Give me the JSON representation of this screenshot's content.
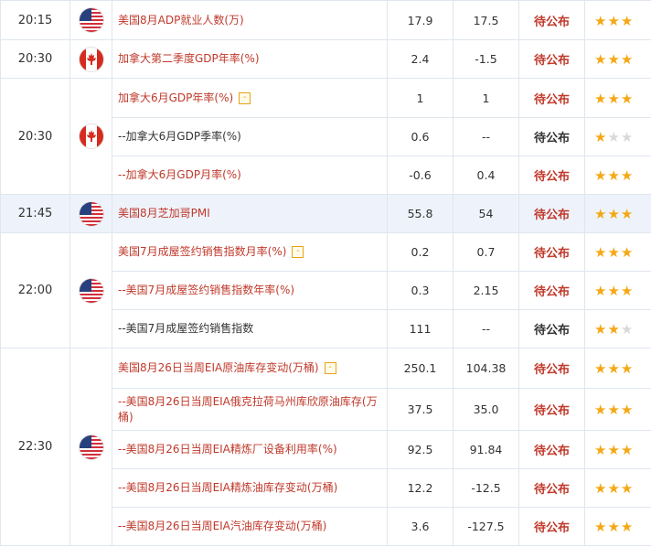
{
  "colors": {
    "accent_red": "#c0392b",
    "star_on": "#f5a814",
    "star_off": "#d9d9d9",
    "highlight_row": "#eef3fb"
  },
  "groups": [
    {
      "time": "20:15",
      "flag": "us-flag-icon",
      "rows": [
        {
          "name": "美国8月ADP就业人数(万)",
          "prev": "17.9",
          "forecast": "17.5",
          "actual": "待公布",
          "stars": 3,
          "badge": false,
          "name_color": "red"
        }
      ]
    },
    {
      "time": "20:30",
      "flag": "ca-flag-icon",
      "rows": [
        {
          "name": "加拿大第二季度GDP年率(%)",
          "prev": "2.4",
          "forecast": "-1.5",
          "actual": "待公布",
          "stars": 3,
          "badge": false,
          "name_color": "red"
        }
      ]
    },
    {
      "time": "20:30",
      "flag": "ca-flag-icon",
      "rows": [
        {
          "name": "加拿大6月GDP年率(%)",
          "prev": "1",
          "forecast": "1",
          "actual": "待公布",
          "stars": 3,
          "badge": true,
          "name_color": "red"
        },
        {
          "name": "--加拿大6月GDP季率(%)",
          "prev": "0.6",
          "forecast": "--",
          "actual": "待公布",
          "stars": 1,
          "badge": false,
          "name_color": "dark"
        },
        {
          "name": "--加拿大6月GDP月率(%)",
          "prev": "-0.6",
          "forecast": "0.4",
          "actual": "待公布",
          "stars": 3,
          "badge": false,
          "name_color": "red"
        }
      ]
    },
    {
      "time": "21:45",
      "flag": "us-flag-icon",
      "highlight": true,
      "rows": [
        {
          "name": "美国8月芝加哥PMI",
          "prev": "55.8",
          "forecast": "54",
          "actual": "待公布",
          "stars": 3,
          "badge": false,
          "name_color": "red"
        }
      ]
    },
    {
      "time": "22:00",
      "flag": "us-flag-icon",
      "rows": [
        {
          "name": "美国7月成屋签约销售指数月率(%)",
          "prev": "0.2",
          "forecast": "0.7",
          "actual": "待公布",
          "stars": 3,
          "badge": true,
          "name_color": "red"
        },
        {
          "name": "--美国7月成屋签约销售指数年率(%)",
          "prev": "0.3",
          "forecast": "2.15",
          "actual": "待公布",
          "stars": 3,
          "badge": false,
          "name_color": "red"
        },
        {
          "name": "--美国7月成屋签约销售指数",
          "prev": "111",
          "forecast": "--",
          "actual": "待公布",
          "stars": 2,
          "badge": false,
          "name_color": "dark"
        }
      ]
    },
    {
      "time": "22:30",
      "flag": "us-flag-icon",
      "rows": [
        {
          "name": "美国8月26日当周EIA原油库存变动(万桶)",
          "prev": "250.1",
          "forecast": "104.38",
          "actual": "待公布",
          "stars": 3,
          "badge": true,
          "name_color": "red"
        },
        {
          "name": "--美国8月26日当周EIA俄克拉荷马州库欣原油库存(万桶)",
          "prev": "37.5",
          "forecast": "35.0",
          "actual": "待公布",
          "stars": 3,
          "badge": false,
          "name_color": "red"
        },
        {
          "name": "--美国8月26日当周EIA精炼厂设备利用率(%)",
          "prev": "92.5",
          "forecast": "91.84",
          "actual": "待公布",
          "stars": 3,
          "badge": false,
          "name_color": "red"
        },
        {
          "name": "--美国8月26日当周EIA精炼油库存变动(万桶)",
          "prev": "12.2",
          "forecast": "-12.5",
          "actual": "待公布",
          "stars": 3,
          "badge": false,
          "name_color": "red"
        },
        {
          "name": "--美国8月26日当周EIA汽油库存变动(万桶)",
          "prev": "3.6",
          "forecast": "-127.5",
          "actual": "待公布",
          "stars": 3,
          "badge": false,
          "name_color": "red"
        }
      ]
    }
  ]
}
